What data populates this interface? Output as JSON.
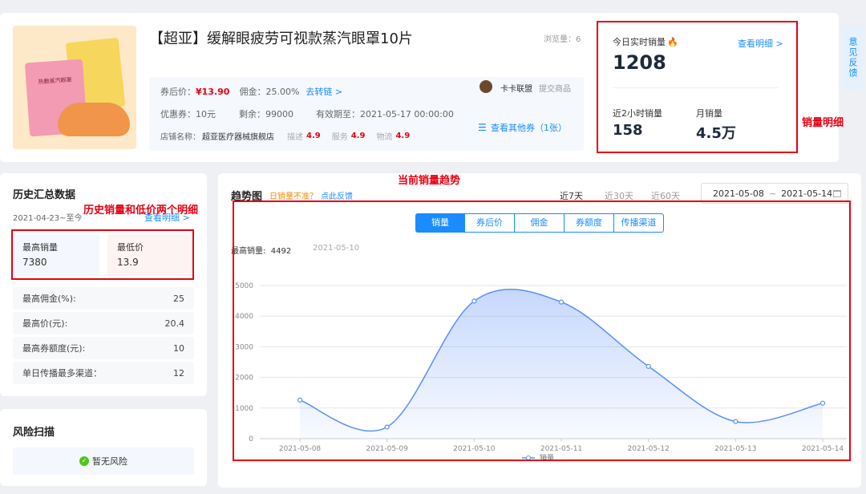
{
  "product": {
    "title": "【超亚】缓解眼疲劳可视款蒸汽眼罩10片",
    "views_label": "浏览量：6",
    "image_caption": "热敷蒸汽眼罩",
    "after_coupon_label": "券后价：",
    "after_coupon_price": "¥13.90",
    "commission_label": "佣金：25.00%",
    "to_convert_link": "去转链 >",
    "coupon_label": "优惠券：10元",
    "remaining_label": "剩余：99000",
    "validity_label": "有效期至：2021-05-17 00:00:00",
    "shop_label": "店铺名称：",
    "shop_name": "超亚医疗器械旗舰店",
    "desc_label": "描述",
    "desc_score": "4.9",
    "service_label": "服务",
    "service_score": "4.9",
    "logistics_label": "物流",
    "logistics_score": "4.9",
    "alliance_name": "卡卡联盟",
    "submit_label": "提交商品",
    "other_coupons_link": "查看其他券（1张）"
  },
  "sales": {
    "today_label": "今日实时销量",
    "today_value": "1208",
    "detail_link": "查看明细 >",
    "two_hours_label": "近2小时销量",
    "two_hours_value": "158",
    "monthly_label": "月销量",
    "monthly_value": "4.5万"
  },
  "feedback_tab": "意见反馈",
  "history": {
    "title": "历史汇总数据",
    "date_range": "2021-04-23~至今",
    "detail_link": "查看明细 >",
    "max_sales_label": "最高销量",
    "max_sales_value": "7380",
    "min_price_label": "最低价",
    "min_price_value": "13.9",
    "rows": [
      {
        "label": "最高佣金(%):",
        "value": "25"
      },
      {
        "label": "最高价(元):",
        "value": "20.4"
      },
      {
        "label": "最高券额度(元):",
        "value": "10"
      },
      {
        "label": "单日传播最多渠道：",
        "value": "12"
      }
    ]
  },
  "risk": {
    "title": "风险扫描",
    "status": "暂无风险",
    "status_color": "#52c41a"
  },
  "trend": {
    "title": "趋势图",
    "inaccurate_label": "日销量不准？",
    "feedback_link": "点此反馈",
    "ranges": [
      "近7天",
      "近30天",
      "近60天"
    ],
    "date_start": "2021-05-08",
    "date_sep": "~",
    "date_end": "2021-05-14",
    "tabs": [
      "销量",
      "券后价",
      "佣金",
      "券额度",
      "传播渠道"
    ],
    "peak_label": "最高销量:  4492",
    "peak_date": "2021-05-10",
    "legend_label": "销量"
  },
  "annotations": {
    "sales_detail": "销量明细",
    "current_trend": "当前销量趋势",
    "history_detail": "历史销量和低价两个明细"
  },
  "chart_data": {
    "type": "area",
    "x": [
      "2021-05-08",
      "2021-05-09",
      "2021-05-10",
      "2021-05-11",
      "2021-05-12",
      "2021-05-13",
      "2021-05-14"
    ],
    "series": [
      {
        "name": "销量",
        "values": [
          1260,
          380,
          4492,
          4460,
          2360,
          560,
          1160
        ]
      }
    ],
    "yticks": [
      0,
      1000,
      2000,
      3000,
      4000,
      5000
    ],
    "ylim": [
      0,
      5000
    ],
    "grid": true,
    "legend": "bottom",
    "color": "#5b8ff9"
  }
}
